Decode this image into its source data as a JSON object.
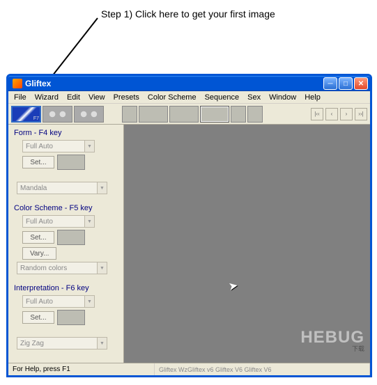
{
  "annotation": "Step 1) Click here to get your first image",
  "window": {
    "title": "Gliftex"
  },
  "menu": [
    "File",
    "Wizard",
    "Edit",
    "View",
    "Presets",
    "Color Scheme",
    "Sequence",
    "Sex",
    "Window",
    "Help"
  ],
  "toolbar": {
    "f7_label": "F7"
  },
  "nav": {
    "first": "|‹‹",
    "prev": "‹",
    "next": "›",
    "last": "››|"
  },
  "panels": {
    "form": {
      "title": "Form - F4 key",
      "mode": "Full Auto",
      "set": "Set...",
      "shape": "Mandala"
    },
    "color": {
      "title": "Color Scheme - F5 key",
      "mode": "Full Auto",
      "set": "Set...",
      "vary": "Vary...",
      "palette": "Random colors"
    },
    "interp": {
      "title": "Interpretation - F6 key",
      "mode": "Full Auto",
      "set": "Set...",
      "style": "Zig Zag"
    }
  },
  "status": {
    "help": "For Help, press F1",
    "info": "Gliftex   WzGliftex v6 Gliftex V6 Gliftex V6"
  },
  "watermark": "HEBUG",
  "watermark_sub": "下载"
}
